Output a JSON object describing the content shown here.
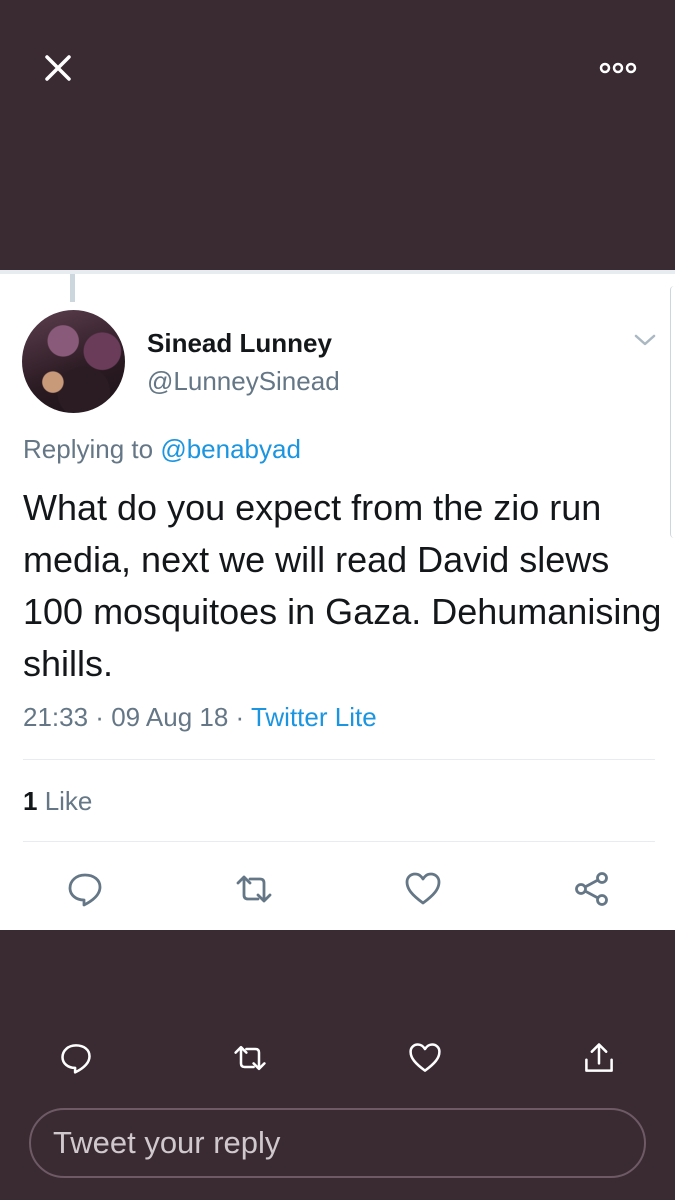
{
  "top_bar": {
    "close_icon": "close-icon",
    "more_icon": "more-options-icon"
  },
  "tweet": {
    "display_name": "Sinead Lunney",
    "handle": "@LunneySinead",
    "replying_prefix": "Replying to ",
    "replying_to": "@benabyad",
    "text": "What do you expect from the zio run media, next we will read David slews 100 mosquitoes in Gaza. Dehumanising shills.",
    "time": "21:33",
    "date": "09 Aug 18",
    "separator": " · ",
    "source": "Twitter Lite",
    "like_count": "1",
    "like_label": " Like"
  },
  "reply_box": {
    "placeholder": "Tweet your reply"
  },
  "colors": {
    "background": "#3a2b33",
    "link": "#1b95e0",
    "secondary_text": "#657786",
    "primary_text": "#14171a",
    "icon_gray": "#657786",
    "bottom_icon": "#ffffff"
  }
}
